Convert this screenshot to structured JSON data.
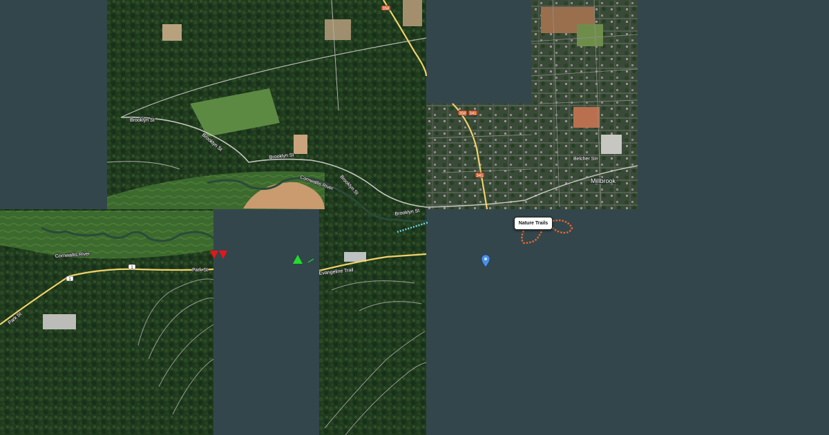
{
  "map": {
    "imagery": "satellite",
    "colors": {
      "background": "#33464c",
      "trail": "#e2682f",
      "boundary_dots": "#6fd3e8",
      "route_line": "#f2d36b",
      "red_marker": "#e8141a",
      "green_marker": "#22dd2a",
      "pin": "#4a90e2"
    },
    "road_labels": [
      "Brooklyn St",
      "Brooklyn St",
      "Brooklyn St",
      "Brooklyn St",
      "Brooklyn St",
      "Belcher St",
      "Park St",
      "Park St",
      "Evangeline Trail"
    ],
    "river_labels": [
      "Cornwallis River",
      "Cornwallis River"
    ],
    "place_labels": [
      "Millbrook"
    ],
    "route_shields": [
      "1",
      "1",
      "358",
      "341",
      "358",
      "341"
    ],
    "popup": {
      "label": "Nature Trails"
    },
    "markers": [
      {
        "type": "red-triangle",
        "count": 2
      },
      {
        "type": "green-triangle",
        "count": 1
      },
      {
        "type": "location-pin",
        "count": 1,
        "icon": "map-pin-icon"
      }
    ]
  }
}
